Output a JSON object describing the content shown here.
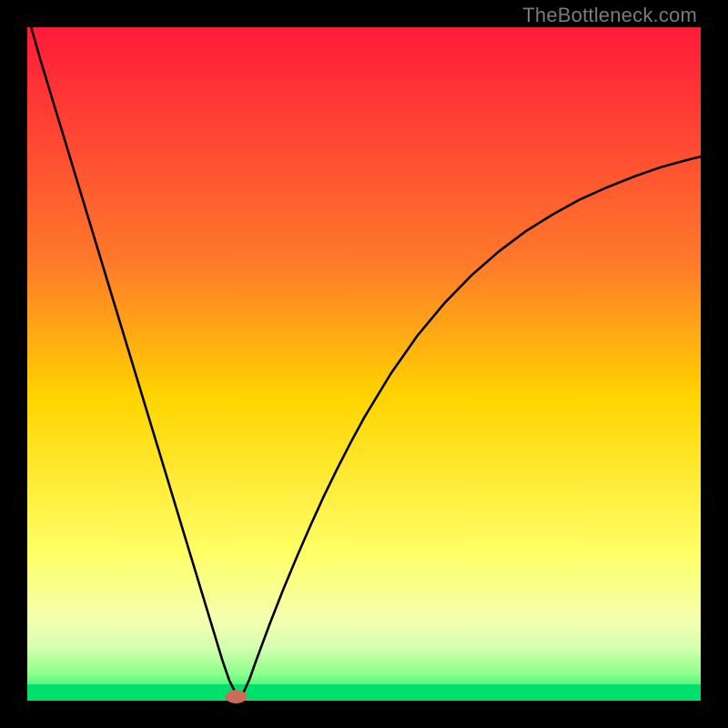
{
  "watermark": "TheBottleneck.com",
  "chart_data": {
    "type": "line",
    "title": "",
    "xlabel": "",
    "ylabel": "",
    "xlim": [
      0,
      100
    ],
    "ylim": [
      0,
      100
    ],
    "gradient_stops": [
      {
        "offset": 0,
        "color": "#ff1a3a"
      },
      {
        "offset": 35,
        "color": "#ff7a2a"
      },
      {
        "offset": 55,
        "color": "#ffd400"
      },
      {
        "offset": 78,
        "color": "#ffff66"
      },
      {
        "offset": 88,
        "color": "#f4ffb0"
      },
      {
        "offset": 92,
        "color": "#d6ffb0"
      },
      {
        "offset": 96,
        "color": "#8dff8d"
      },
      {
        "offset": 100,
        "color": "#00e56a"
      }
    ],
    "green_band_height_pct": 2.4,
    "series": [
      {
        "name": "bottleneck-curve",
        "x": [
          0,
          2,
          4,
          6,
          8,
          10,
          12,
          14,
          16,
          18,
          20,
          22,
          24,
          26,
          28,
          29,
          30,
          31,
          32,
          33,
          34,
          36,
          38,
          40,
          42,
          44,
          46,
          48,
          50,
          54,
          58,
          62,
          66,
          70,
          74,
          78,
          82,
          86,
          90,
          94,
          98,
          100
        ],
        "y": [
          102,
          95,
          88.4,
          81.8,
          75.2,
          68.6,
          62,
          55.4,
          48.8,
          42.2,
          35.6,
          29,
          22.4,
          15.8,
          9.2,
          5.9,
          3.0,
          1.0,
          1.0,
          3.2,
          6.0,
          11.4,
          16.5,
          21.3,
          25.9,
          30.3,
          34.4,
          38.3,
          42.0,
          48.6,
          54.3,
          59.1,
          63.2,
          66.7,
          69.7,
          72.2,
          74.4,
          76.2,
          77.8,
          79.2,
          80.3,
          80.8
        ]
      }
    ],
    "marker": {
      "x": 31,
      "y": 0.6,
      "color": "#cc6a5c",
      "rx": 1.6,
      "ry": 1.0
    }
  }
}
